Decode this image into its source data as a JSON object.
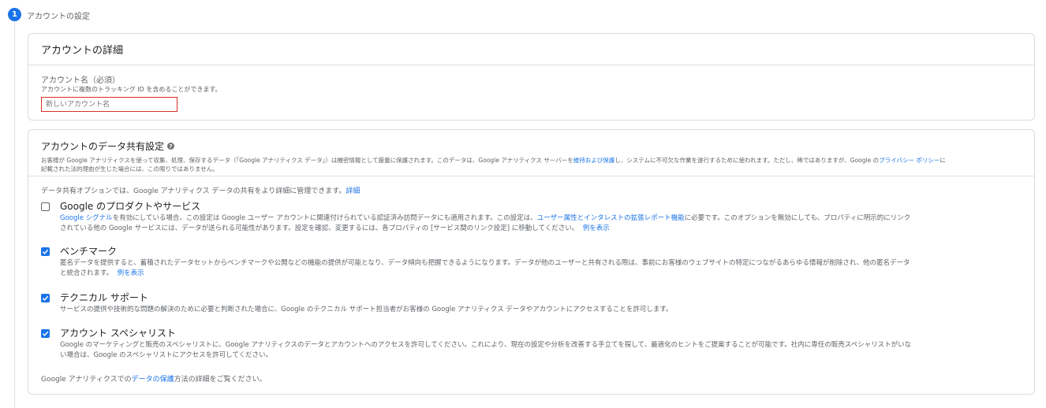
{
  "step": {
    "number": "1",
    "title": "アカウントの設定"
  },
  "account_details": {
    "heading": "アカウントの詳細",
    "name_label": "アカウント名（必須）",
    "name_help": "アカウントに複数のトラッキング ID を含めることができます。",
    "name_placeholder": "新しいアカウント名"
  },
  "data_sharing": {
    "heading": "アカウントのデータ共有設定",
    "desc_line1_a": "お客様が Google アナリティクスを使って収集、処理、保存するデータ（「Google アナリティクス データ」）は機密情報として厳重に保護されます。このデータは、Google アナリティクス サーバーを",
    "desc_line1_link1": "維持および保護",
    "desc_line1_b": "し、システムに不可欠な作業を遂行するために使われます。ただし、稀ではありますが、Google の",
    "desc_line1_link2": "プライバシー ポリシー",
    "desc_line1_c": "に",
    "desc_line2": "記載された法的理由が生じた場合には、この限りではありません。",
    "intro_text": "データ共有オプションでは、Google アナリティクス データの共有をより詳細に管理できます。",
    "intro_link": "詳細",
    "options": [
      {
        "title": "Google のプロダクトやサービス",
        "checked": false,
        "line1_link1": "Google シグナル",
        "line1_a": "を有効にしている場合、この設定は Google ユーザー アカウントに関連付けられている認証済み訪問データにも適用されます。この設定は、",
        "line1_link2": "ユーザー属性とインタレストの拡張レポート機能",
        "line1_b": "に必要です。このオプションを無効にしても、プロパティに明示的にリンク",
        "line2": "されている他の Google サービスには、データが送られる可能性があります。設定を確認、変更するには、各プロパティの [サービス間のリンク設定] に移動してください。",
        "line2_link": "例を表示"
      },
      {
        "title": "ベンチマーク",
        "checked": true,
        "line1": "匿名データを提供すると、蓄積されたデータセットからベンチマークや公開などの機能の提供が可能となり、データ傾向も把握できるようになります。データが他のユーザーと共有される際は、事前にお客様のウェブサイトの特定につながるあらゆる情報が削除され、他の匿名データ",
        "line2": "と統合されます。",
        "line2_link": "例を表示"
      },
      {
        "title": "テクニカル サポート",
        "checked": true,
        "line1": "サービスの提供や技術的な問題の解決のために必要と判断された場合に、Google のテクニカル サポート担当者がお客様の Google アナリティクス データやアカウントにアクセスすることを許可します。"
      },
      {
        "title": "アカウント スペシャリスト",
        "checked": true,
        "line1": "Google のマーケティングと販売のスペシャリストに、Google アナリティクスのデータとアカウントへのアクセスを許可してください。これにより、現在の設定や分析を改善する手立てを探して、最適化のヒントをご提案することが可能です。社内に専任の販売スペシャリストがいな",
        "line2": "い場合は、Google のスペシャリストにアクセスを許可してください。"
      }
    ],
    "footer_a": "Google アナリティクスでの",
    "footer_link": "データの保護",
    "footer_b": "方法の詳細をご覧ください。"
  },
  "colors": {
    "accent": "#1a73e8",
    "error_border": "#d93025"
  }
}
